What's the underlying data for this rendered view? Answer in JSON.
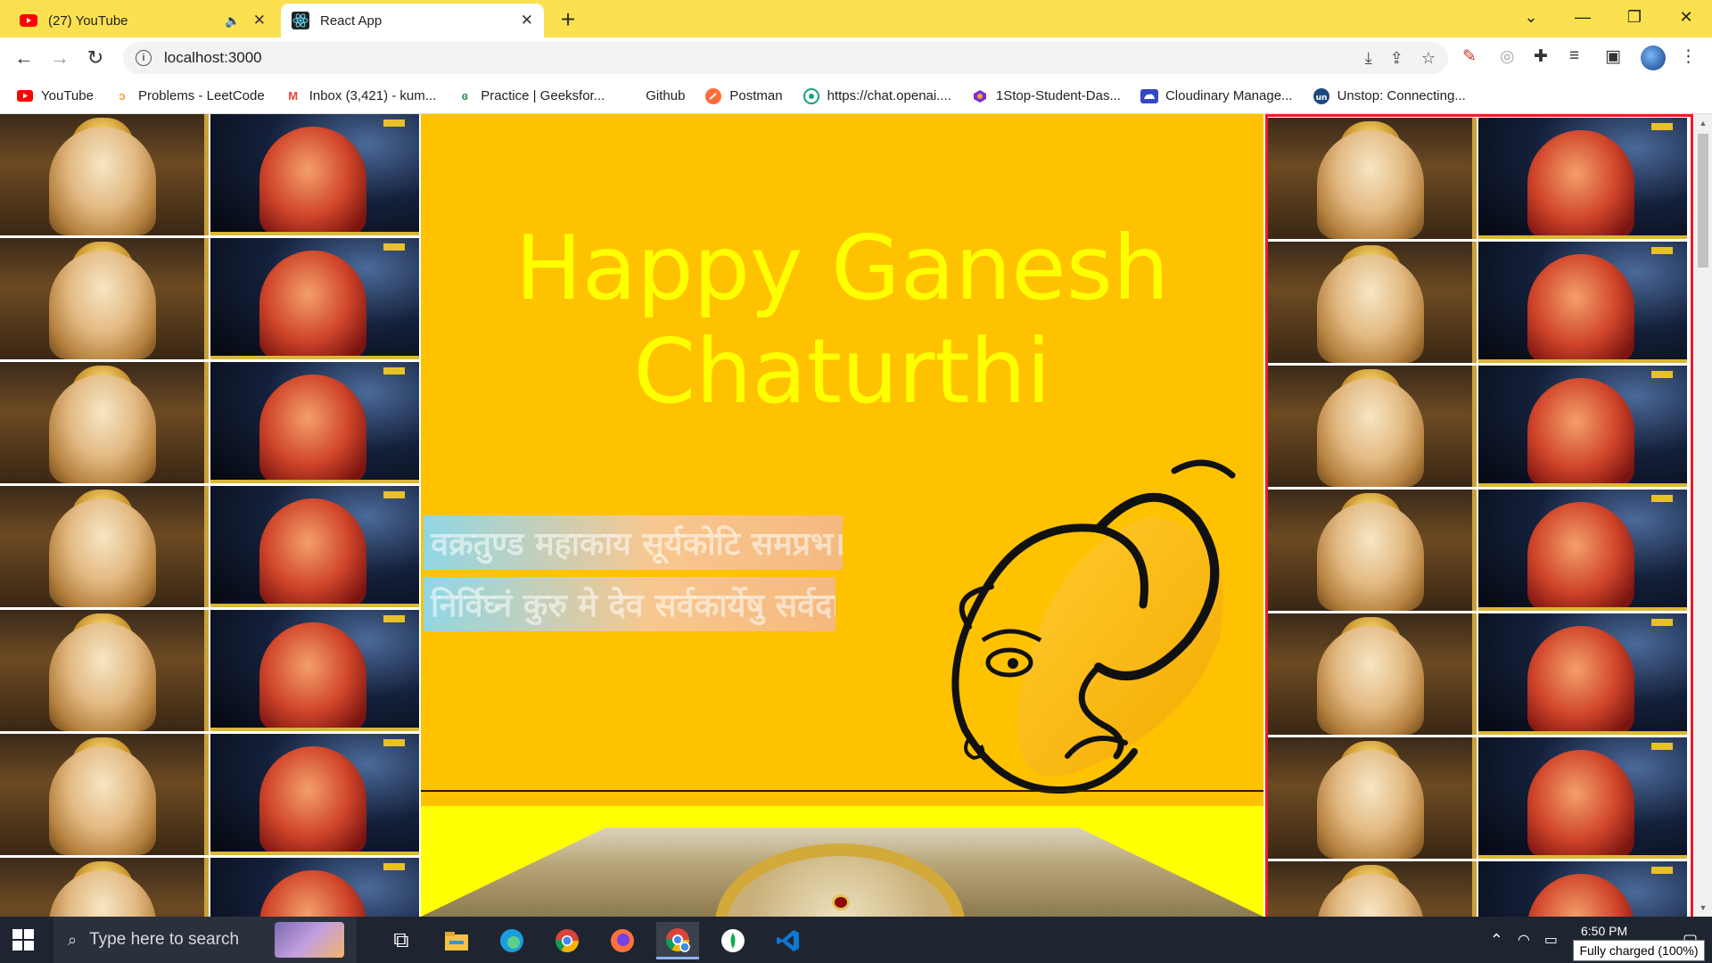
{
  "browser": {
    "tabs": [
      {
        "label": "(27) YouTube",
        "favicon": "youtube-icon",
        "muted": true
      },
      {
        "label": "React App",
        "favicon": "react-icon",
        "active": true
      }
    ],
    "new_tab": "+",
    "address": "localhost:3000",
    "bookmarks": [
      {
        "label": "YouTube",
        "icon": "youtube-icon",
        "color": "#ff0000"
      },
      {
        "label": "Problems - LeetCode",
        "icon": "leetcode-icon",
        "color": "#f89f1b"
      },
      {
        "label": "Inbox (3,421) - kum...",
        "icon": "gmail-icon",
        "color": "#ea4335"
      },
      {
        "label": "Practice | Geeksfor...",
        "icon": "gfg-icon",
        "color": "#2f8d46"
      },
      {
        "label": "Github",
        "icon": "none"
      },
      {
        "label": "Postman",
        "icon": "postman-icon",
        "color": "#ff6c37"
      },
      {
        "label": "https://chat.openai....",
        "icon": "openai-icon",
        "color": "#10a37f"
      },
      {
        "label": "1Stop-Student-Das...",
        "icon": "onestop-icon",
        "color": "#7a2fd1"
      },
      {
        "label": "Cloudinary Manage...",
        "icon": "cloudinary-icon",
        "color": "#3448c5"
      },
      {
        "label": "Unstop: Connecting...",
        "icon": "unstop-icon",
        "color": "#1c4980"
      }
    ]
  },
  "page": {
    "headline_line1": "Happy Ganesh",
    "headline_line2": "Chaturthi",
    "mantra_line1": "वक्रतुण्ड महाकाय सूर्यकोटि समप्रभ।",
    "mantra_line2": "निर्विघ्नं कुरु मे देव सर्वकार्येषु सर्वदा॥",
    "colors": {
      "background": "#ffc200",
      "headline": "#ffff00",
      "band": "#ffff00",
      "frame": "#ee1c24"
    }
  },
  "taskbar": {
    "search_placeholder": "Type here to search",
    "time": "6:50 PM",
    "battery_tooltip": "Fully charged (100%)",
    "apps": [
      "task-view-icon",
      "file-explorer-icon",
      "edge-icon",
      "chrome-icon",
      "firefox-icon",
      "chrome-profile-icon",
      "mongodb-icon",
      "vscode-icon"
    ]
  }
}
